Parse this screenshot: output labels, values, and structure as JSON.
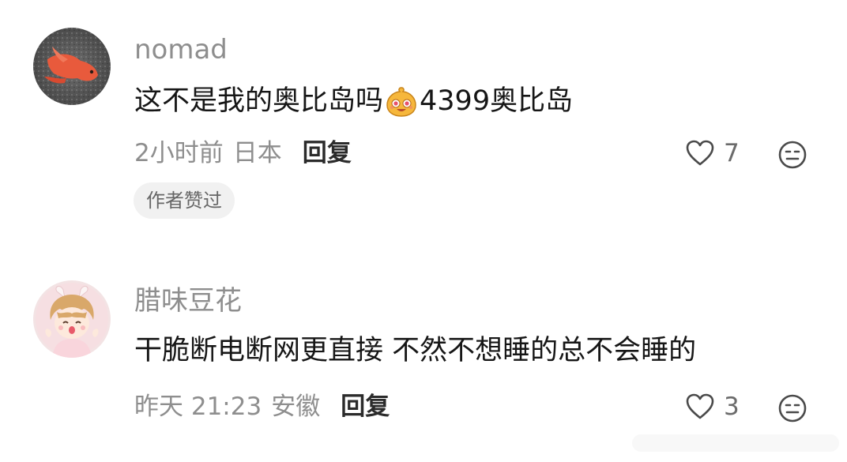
{
  "comments": [
    {
      "username": "nomad",
      "text_before": "这不是我的奥比岛吗",
      "emoji": "yellow-cute-face-emoji",
      "text_after": "4399奥比岛",
      "time": "2小时前",
      "location": "日本",
      "reply_label": "回复",
      "likes": "7",
      "badge": "作者赞过",
      "avatar": "red-bird-on-gravel-avatar"
    },
    {
      "username": "腊味豆花",
      "text": "干脆断电断网更直接 不然不想睡的总不会睡的",
      "time": "昨天 21:23",
      "location": "安徽",
      "reply_label": "回复",
      "likes": "3",
      "avatar": "anime-girl-avatar"
    }
  ],
  "icons": {
    "like": "heart-outline-icon",
    "react": "neutral-face-icon"
  },
  "colors": {
    "text": "#161616",
    "meta": "#8e8e8e",
    "badge_bg": "#f1f1f1"
  }
}
